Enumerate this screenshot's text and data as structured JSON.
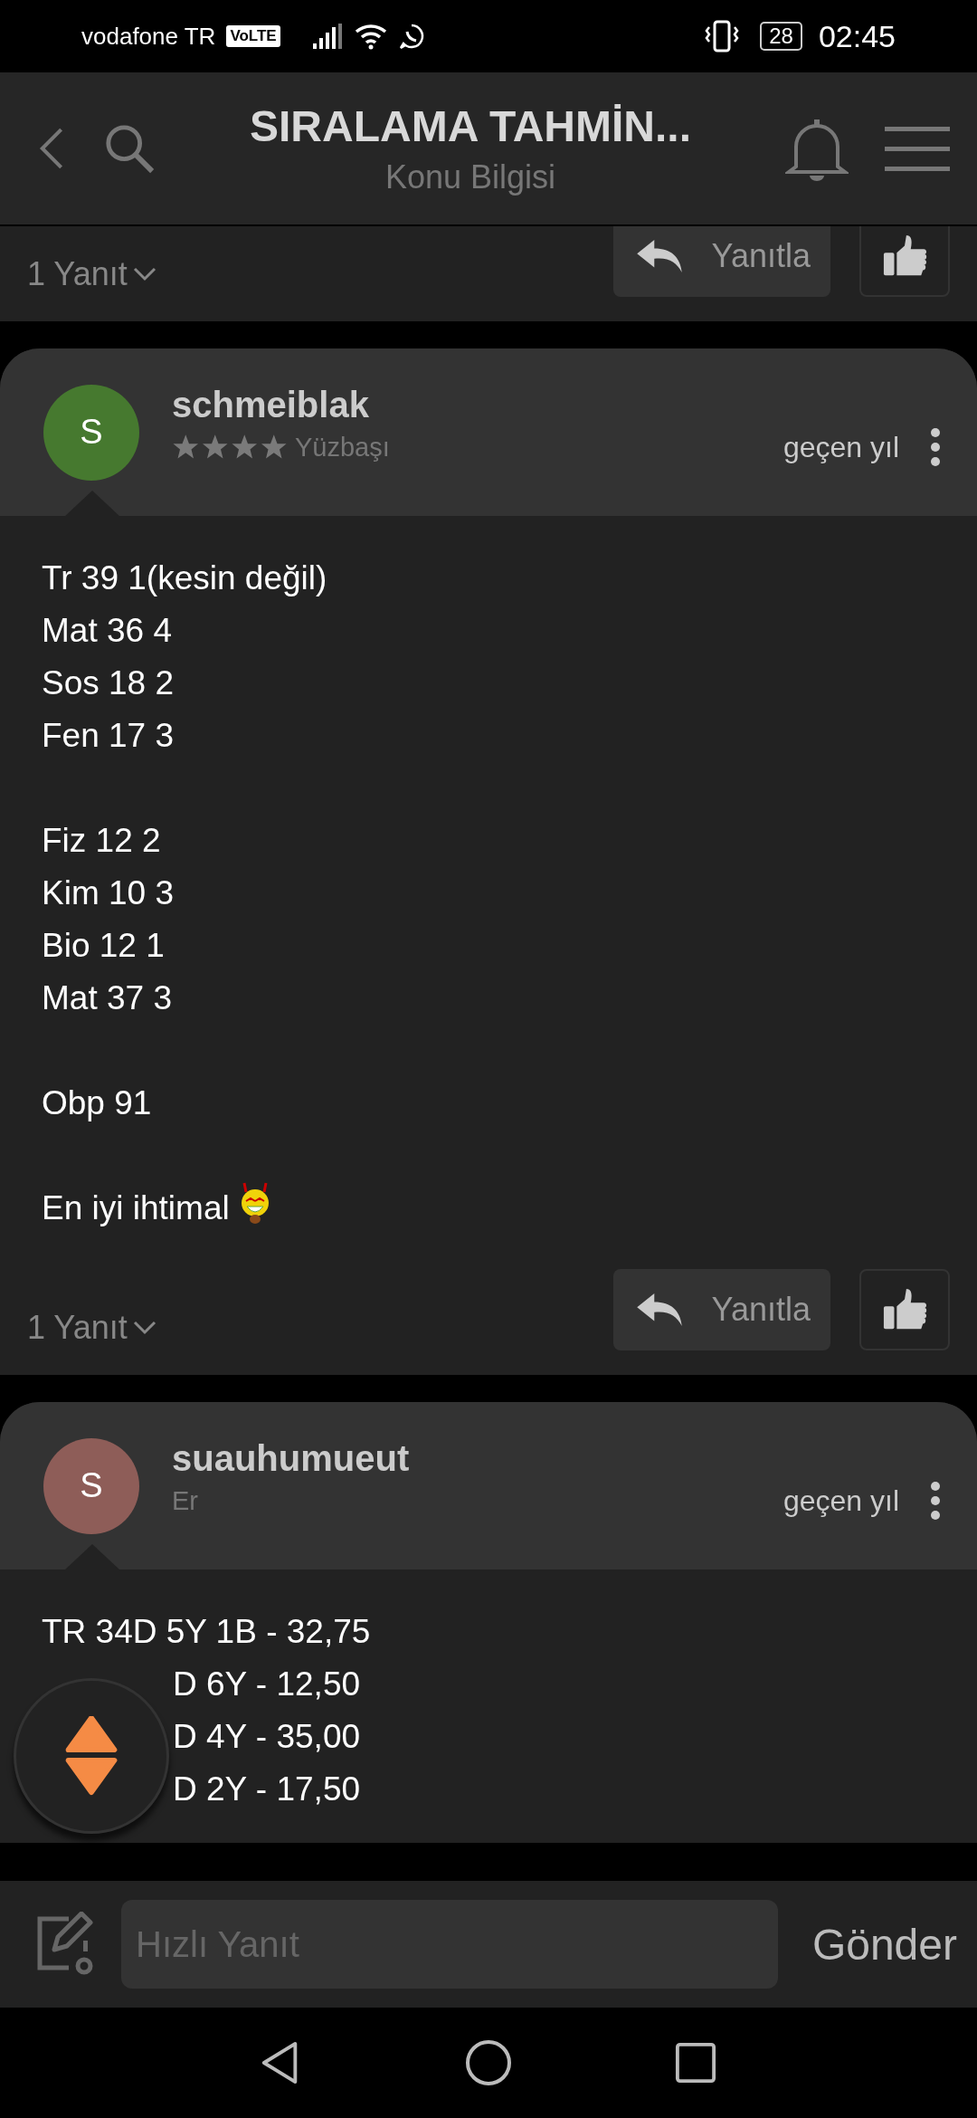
{
  "status_bar": {
    "carrier": "vodafone TR",
    "network_badge": "VoLTE",
    "battery": "28",
    "time": "02:45"
  },
  "header": {
    "title": "SIRALAMA TAHMİN...",
    "subtitle": "Konu Bilgisi"
  },
  "previous_post_footer": {
    "replies": "1 Yanıt",
    "reply_button": "Yanıtla"
  },
  "posts": [
    {
      "avatar_letter": "S",
      "color": "#46792f",
      "username": "schmeiblak",
      "kind": "starred",
      "rank": "Yüzbaşı",
      "time": "geçen yıl",
      "ends_with_emoji": true,
      "groups": [
        [
          "Tr 39 1(kesin değil)",
          "Mat 36 4",
          "Sos 18 2",
          "Fen 17 3"
        ],
        [
          "Fiz 12 2",
          "Kim 10 3",
          "Bio 12 1",
          "Mat 37 3"
        ],
        [
          "Obp 91"
        ],
        [
          "En iyi ihtimal"
        ]
      ],
      "footer": {
        "replies": "1 Yanıt",
        "reply_button": "Yanıtla"
      }
    },
    {
      "avatar_letter": "S",
      "color": "#8e5d58",
      "username": "suauhumueut",
      "kind": "plain",
      "rank": "Er",
      "time": "geçen yıl",
      "ends_with_emoji": false,
      "groups": [
        [
          {
            "text": "TR 34D 5Y 1B - 32,75",
            "covered": false
          },
          {
            "text": "D 6Y - 12,50",
            "covered": true
          },
          {
            "text": "D 4Y - 35,00",
            "covered": true
          },
          {
            "text": "D 2Y - 17,50",
            "covered": true
          }
        ]
      ]
    }
  ],
  "composer": {
    "placeholder": "Hızlı Yanıt",
    "send_button": "Gönder"
  }
}
